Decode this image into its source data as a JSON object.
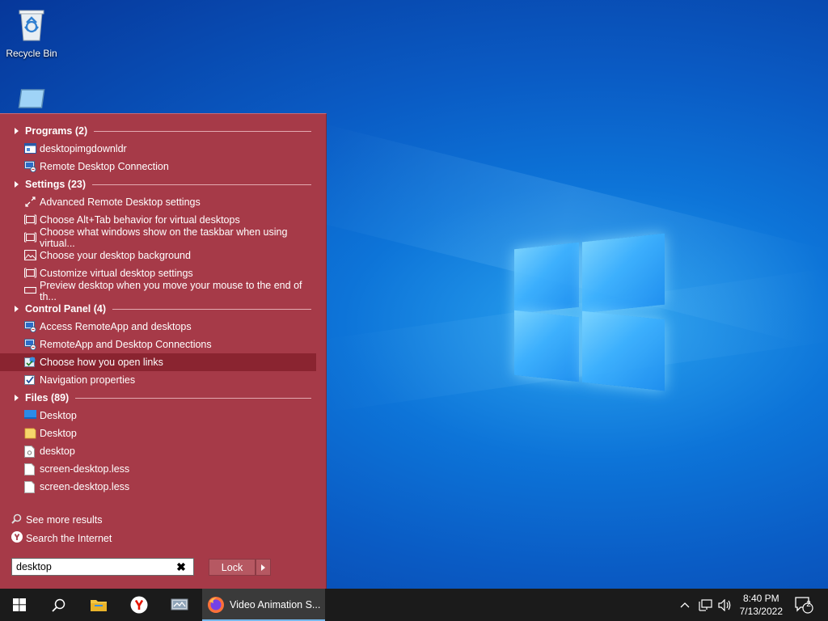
{
  "desktop": {
    "icons": [
      {
        "label": "Recycle Bin",
        "icon": "recycle-bin-icon"
      },
      {
        "label": "",
        "icon": "this-pc-icon"
      }
    ]
  },
  "start_menu": {
    "groups": [
      {
        "title": "Programs (2)",
        "items": [
          {
            "label": "desktopimgdownldr",
            "icon": "app-window-icon"
          },
          {
            "label": "Remote Desktop Connection",
            "icon": "remote-desktop-icon"
          }
        ]
      },
      {
        "title": "Settings (23)",
        "items": [
          {
            "label": "Advanced Remote Desktop settings",
            "icon": "remote-arrows-icon"
          },
          {
            "label": "Choose Alt+Tab behavior for virtual desktops",
            "icon": "virtual-desktop-icon"
          },
          {
            "label": "Choose what windows show on the taskbar when using virtual...",
            "icon": "virtual-desktop-icon"
          },
          {
            "label": "Choose your desktop background",
            "icon": "picture-icon"
          },
          {
            "label": "Customize virtual desktop settings",
            "icon": "virtual-desktop-icon"
          },
          {
            "label": "Preview desktop when you move your mouse to the end of th...",
            "icon": "taskbar-icon"
          }
        ]
      },
      {
        "title": "Control Panel (4)",
        "items": [
          {
            "label": "Access RemoteApp and desktops",
            "icon": "remote-desktop-icon"
          },
          {
            "label": "RemoteApp and Desktop Connections",
            "icon": "remote-desktop-icon"
          },
          {
            "label": "Choose how you open links",
            "icon": "internet-options-icon",
            "selected": true
          },
          {
            "label": "Navigation properties",
            "icon": "checkbox-icon"
          }
        ]
      },
      {
        "title": "Files (89)",
        "items": [
          {
            "label": "Desktop",
            "icon": "desktop-folder-icon"
          },
          {
            "label": "Desktop",
            "icon": "folder-icon"
          },
          {
            "label": "desktop",
            "icon": "settings-file-icon"
          },
          {
            "label": "screen-desktop.less",
            "icon": "file-icon"
          },
          {
            "label": "screen-desktop.less",
            "icon": "file-icon"
          }
        ]
      }
    ],
    "see_more": "See more results",
    "search_internet": "Search the Internet",
    "search_value": "desktop",
    "lock_label": "Lock"
  },
  "taskbar": {
    "active_app_label": "Video Animation S...",
    "time": "8:40 PM",
    "date": "7/13/2022",
    "notification_count": "2"
  },
  "colors": {
    "menu_bg": "#a63a48",
    "menu_selected": "#8a2430",
    "taskbar_bg": "#1b1b1b"
  }
}
